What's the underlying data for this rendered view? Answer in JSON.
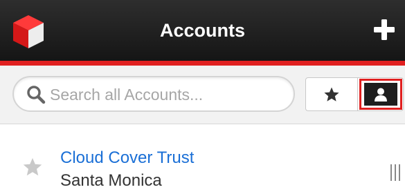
{
  "header": {
    "title": "Accounts",
    "logo_icon": "red-cube-logo-icon",
    "add_icon": "plus-icon"
  },
  "colors": {
    "accent_red": "#e02020",
    "header_bg": "#1e1e1e",
    "link_blue": "#1a6fd6"
  },
  "search": {
    "placeholder": "Search all Accounts...",
    "value": "",
    "icon": "search-icon"
  },
  "filter": {
    "favorites_icon": "star-icon",
    "mine_icon": "person-icon",
    "selected": "mine"
  },
  "accounts": [
    {
      "name": "Cloud Cover Trust",
      "city": "Santa Monica",
      "favorite": false
    }
  ]
}
